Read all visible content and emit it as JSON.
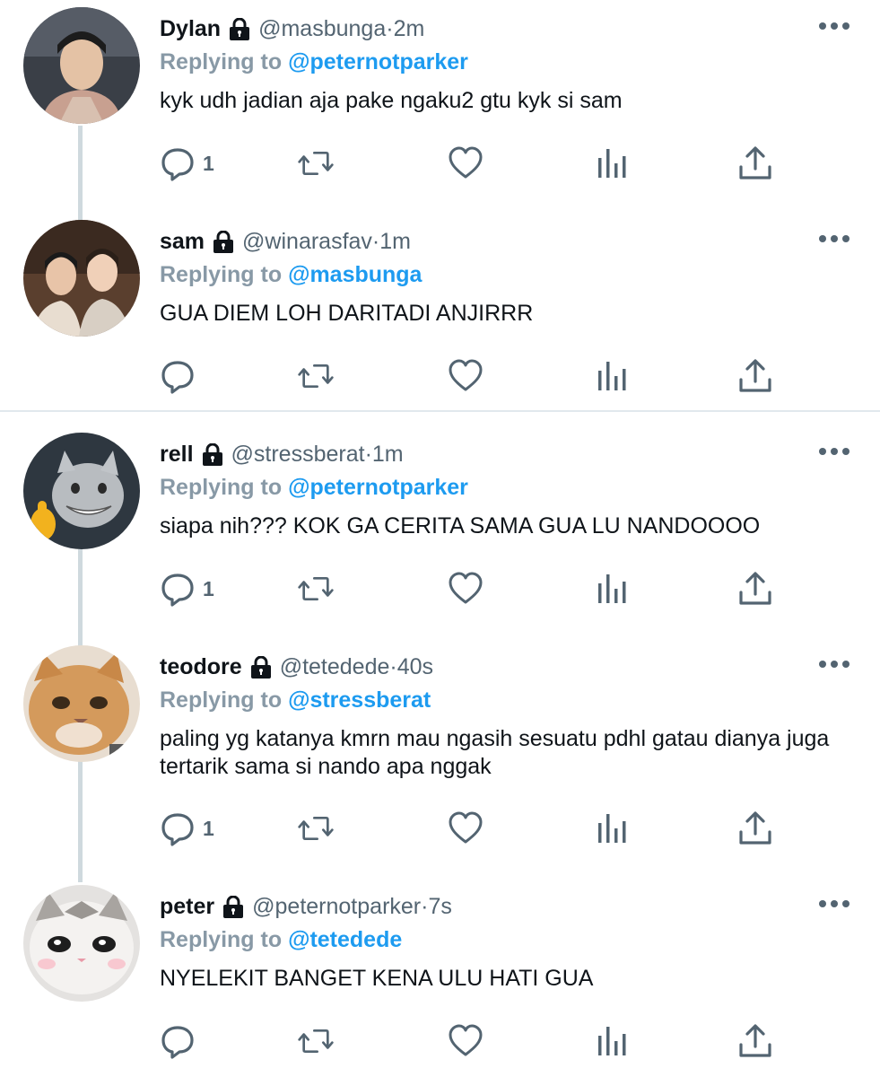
{
  "tweets": [
    {
      "name": "Dylan",
      "handle": "@masbunga",
      "time": "2m",
      "reply_prefix": "Replying to",
      "reply_to": "@peternotparker",
      "text": "kyk udh jadian aja pake ngaku2 gtu kyk si sam",
      "reply_count": "1"
    },
    {
      "name": "sam",
      "handle": "@winarasfav",
      "time": "1m",
      "reply_prefix": "Replying to",
      "reply_to": "@masbunga",
      "text": "GUA DIEM LOH DARITADI ANJIRRR",
      "reply_count": ""
    },
    {
      "name": "rell",
      "handle": "@stressberat",
      "time": "1m",
      "reply_prefix": "Replying to",
      "reply_to": "@peternotparker",
      "text": "siapa nih??? KOK GA CERITA SAMA GUA LU NANDOOOO",
      "reply_count": "1"
    },
    {
      "name": "teodore",
      "handle": "@tetedede",
      "time": "40s",
      "reply_prefix": "Replying to",
      "reply_to": "@stressberat",
      "text": "paling yg katanya kmrn mau ngasih sesuatu pdhl gatau dianya juga tertarik sama si nando apa nggak",
      "reply_count": "1"
    },
    {
      "name": "peter",
      "handle": "@peternotparker",
      "time": "7s",
      "reply_prefix": "Replying to",
      "reply_to": "@tetedede",
      "text": "NYELEKIT BANGET KENA ULU HATI GUA",
      "reply_count": ""
    }
  ],
  "separator": " · ",
  "colors": {
    "link": "#1d9bf0",
    "muted": "#536471",
    "reply_prefix": "#8899a6",
    "thread_line": "#cfd9de"
  },
  "icons": [
    "lock-icon",
    "more-icon",
    "reply-icon",
    "retweet-icon",
    "like-icon",
    "views-icon",
    "share-icon"
  ]
}
